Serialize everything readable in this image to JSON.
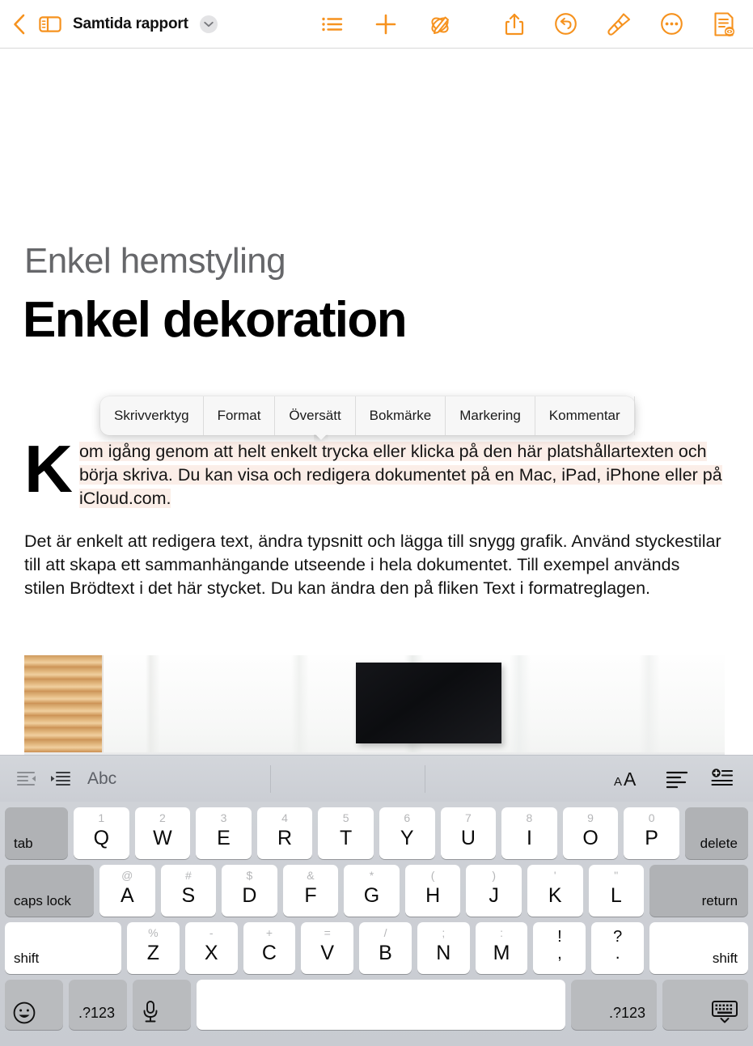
{
  "toolbar": {
    "back_icon": "back-chevron-icon",
    "sidebar_icon": "sidebar-toggle-icon",
    "doc_title": "Samtida rapport",
    "title_chevron_icon": "chevron-down-icon",
    "list_icon": "list-view-icon",
    "add_icon": "insert-plus-icon",
    "draw_icon": "smart-annotation-icon",
    "share_icon": "share-icon",
    "undo_icon": "undo-icon",
    "brush_icon": "format-brush-icon",
    "more_icon": "more-ellipsis-icon",
    "document_icon": "document-options-icon"
  },
  "document": {
    "subtitle": "Enkel hemstyling",
    "title": "Enkel dekoration",
    "dropcap": "K",
    "paragraph1_rest": "om igång genom att helt enkelt trycka eller klicka på den här platshållartexten och börja skriva. Du kan visa och redigera dokumentet på en Mac, iPad, iPhone eller på iCloud.com.",
    "paragraph2": "Det är enkelt att redigera text, ändra typsnitt och lägga till snygg grafik. Använd styckestilar till att skapa ett sammanhängande utseende i hela dokumentet. Till exempel används stilen Brödtext i det här stycket. Du kan ändra den på fliken Text i formatreglagen.",
    "photo_alt": "interior-photo"
  },
  "edit_popup": {
    "items": [
      {
        "label": "Skrivverktyg"
      },
      {
        "label": "Format"
      },
      {
        "label": "Översätt"
      },
      {
        "label": "Bokmärke"
      },
      {
        "label": "Markering"
      },
      {
        "label": "Kommentar"
      }
    ]
  },
  "accessory_bar": {
    "outdent_icon": "outdent-icon",
    "indent_icon": "indent-icon",
    "abc_label": "Abc",
    "text_size_icon": "text-size-aA-icon",
    "align_icon": "paragraph-align-icon",
    "insert_icon": "insert-item-icon"
  },
  "keyboard": {
    "rows": [
      {
        "keys": [
          {
            "main": "tab",
            "hint": "",
            "style": "dark"
          },
          {
            "main": "Q",
            "hint": "1"
          },
          {
            "main": "W",
            "hint": "2"
          },
          {
            "main": "E",
            "hint": "3"
          },
          {
            "main": "R",
            "hint": "4"
          },
          {
            "main": "T",
            "hint": "5"
          },
          {
            "main": "Y",
            "hint": "6"
          },
          {
            "main": "U",
            "hint": "7"
          },
          {
            "main": "I",
            "hint": "8"
          },
          {
            "main": "O",
            "hint": "9"
          },
          {
            "main": "P",
            "hint": "0"
          },
          {
            "main": "delete",
            "hint": "",
            "style": "dark"
          }
        ]
      },
      {
        "keys": [
          {
            "main": "caps lock",
            "hint": "",
            "style": "dark"
          },
          {
            "main": "A",
            "hint": "@"
          },
          {
            "main": "S",
            "hint": "#"
          },
          {
            "main": "D",
            "hint": "$"
          },
          {
            "main": "F",
            "hint": "&"
          },
          {
            "main": "G",
            "hint": "*"
          },
          {
            "main": "H",
            "hint": "("
          },
          {
            "main": "J",
            "hint": ")"
          },
          {
            "main": "K",
            "hint": "'"
          },
          {
            "main": "L",
            "hint": "\""
          },
          {
            "main": "return",
            "hint": "",
            "style": "dark"
          }
        ]
      },
      {
        "keys": [
          {
            "main": "shift",
            "hint": ""
          },
          {
            "main": "Z",
            "hint": "%"
          },
          {
            "main": "X",
            "hint": "-"
          },
          {
            "main": "C",
            "hint": "+"
          },
          {
            "main": "V",
            "hint": "="
          },
          {
            "main": "B",
            "hint": "/"
          },
          {
            "main": "N",
            "hint": ";"
          },
          {
            "main": "M",
            "hint": ":"
          },
          {
            "main": ",",
            "hint": "!"
          },
          {
            "main": ".",
            "hint": "?"
          },
          {
            "main": "shift",
            "hint": ""
          }
        ]
      }
    ],
    "bottom_row": {
      "emoji_icon": "emoji-smiley-icon",
      "numbers_left": ".?123",
      "mic_icon": "microphone-icon",
      "space_label": "",
      "numbers_right": ".?123",
      "hide_keyboard_icon": "hide-keyboard-icon"
    }
  },
  "colors": {
    "accent": "#F6921E",
    "highlight": "#FBEEE8",
    "keyboard_bg": "#CBCED4",
    "key_white": "#FFFFFF",
    "key_dark": "#B0B2B5"
  }
}
